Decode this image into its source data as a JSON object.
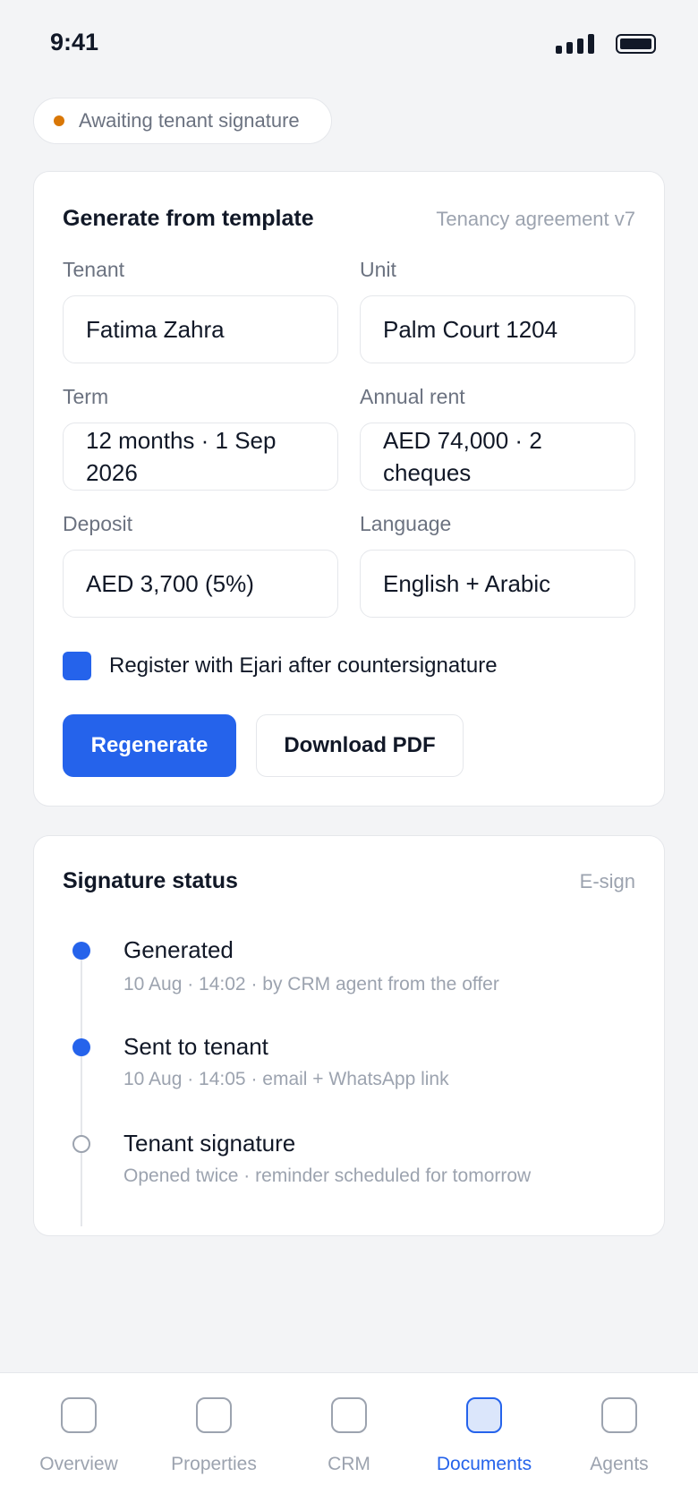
{
  "status_bar": {
    "time": "9:41"
  },
  "status_pill": {
    "label": "Awaiting tenant signature",
    "dot_color": "#d97706"
  },
  "template_card": {
    "title": "Generate from template",
    "template_name": "Tenancy agreement v7",
    "fields": {
      "tenant": {
        "label": "Tenant",
        "value": "Fatima Zahra"
      },
      "unit": {
        "label": "Unit",
        "value": "Palm Court 1204"
      },
      "term": {
        "label": "Term",
        "value": "12 months · 1 Sep 2026"
      },
      "annual_rent": {
        "label": "Annual rent",
        "value": "AED 74,000 · 2 cheques"
      },
      "deposit": {
        "label": "Deposit",
        "value": "AED 3,700 (5%)"
      },
      "language": {
        "label": "Language",
        "value": "English + Arabic"
      }
    },
    "ejari_checkbox": {
      "label": "Register with Ejari after countersignature",
      "checked": true
    },
    "regenerate_label": "Regenerate",
    "download_label": "Download PDF"
  },
  "signature_card": {
    "title": "Signature status",
    "meta": "E-sign",
    "steps": [
      {
        "title": "Generated",
        "detail": "10 Aug · 14:02 · by CRM agent from the offer",
        "done": true
      },
      {
        "title": "Sent to tenant",
        "detail": "10 Aug · 14:05 · email + WhatsApp link",
        "done": true
      },
      {
        "title": "Tenant signature",
        "detail": "Opened twice · reminder scheduled for tomorrow",
        "done": false
      }
    ]
  },
  "tabbar": {
    "tabs": [
      {
        "label": "Overview"
      },
      {
        "label": "Properties"
      },
      {
        "label": "CRM"
      },
      {
        "label": "Documents",
        "active": true
      },
      {
        "label": "Agents"
      }
    ]
  },
  "colors": {
    "accent": "#2563eb",
    "background": "#f3f4f6",
    "warning": "#d97706"
  }
}
